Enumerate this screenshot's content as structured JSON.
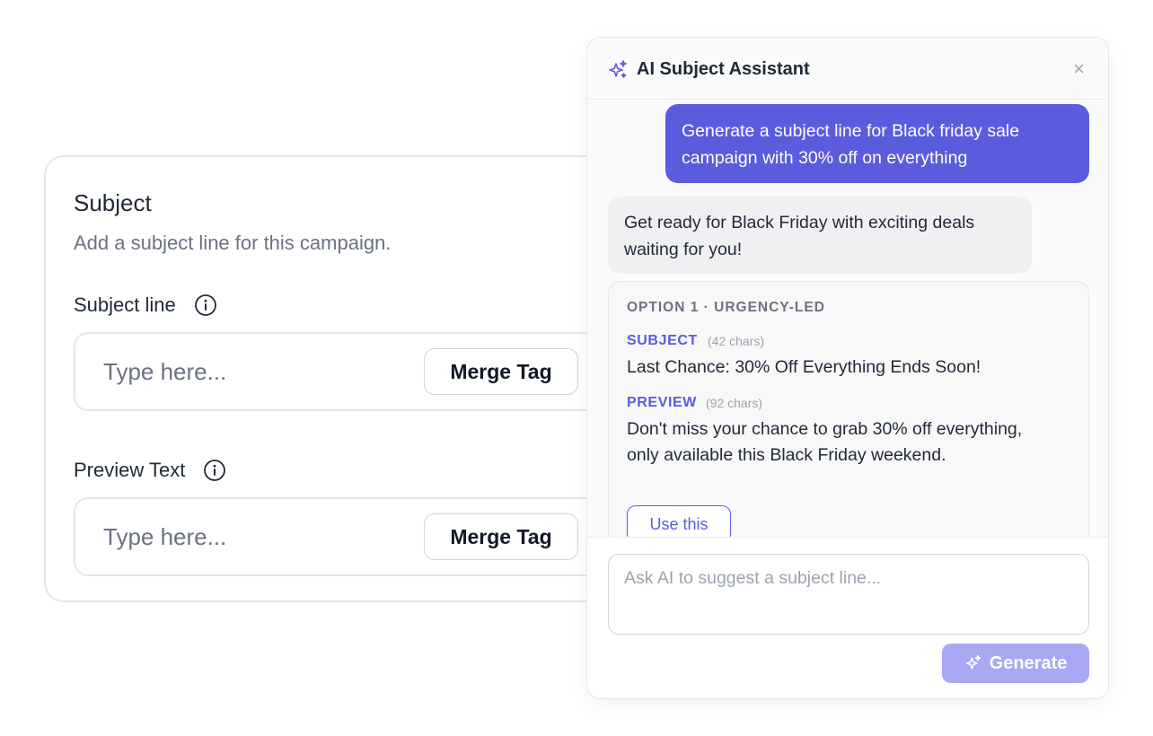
{
  "subject_card": {
    "title": "Subject",
    "description": "Add a subject line for this campaign.",
    "subject_field": {
      "label": "Subject line",
      "placeholder": "Type here...",
      "merge_label": "Merge Tag"
    },
    "preview_field": {
      "label": "Preview Text",
      "placeholder": "Type here...",
      "merge_label": "Merge Tag"
    }
  },
  "ai_panel": {
    "title": "AI Subject Assistant",
    "close_symbol": "×",
    "user_message": "Generate a subject line for Black friday sale campaign with 30% off on everything",
    "ai_message": "Get ready for Black Friday with exciting deals waiting for you!",
    "option": {
      "heading": "OPTION 1 · URGENCY-LED",
      "subject_tag": "SUBJECT",
      "subject_chars": "(42 chars)",
      "subject_text": "Last Chance: 30% Off Everything Ends Soon!",
      "preview_tag": "PREVIEW",
      "preview_chars": "(92 chars)",
      "preview_text": "Don't miss your chance to grab 30% off everything, only available this Black Friday weekend.",
      "use_label": "Use this"
    },
    "composer": {
      "placeholder": "Ask AI to suggest a subject line...",
      "generate_label": "Generate"
    }
  },
  "colors": {
    "accent": "#5b5bde",
    "accent_disabled": "#a8a8f3",
    "border": "#e6e4f1"
  },
  "icons": [
    "info-icon",
    "sparkle-icon",
    "close-icon"
  ]
}
